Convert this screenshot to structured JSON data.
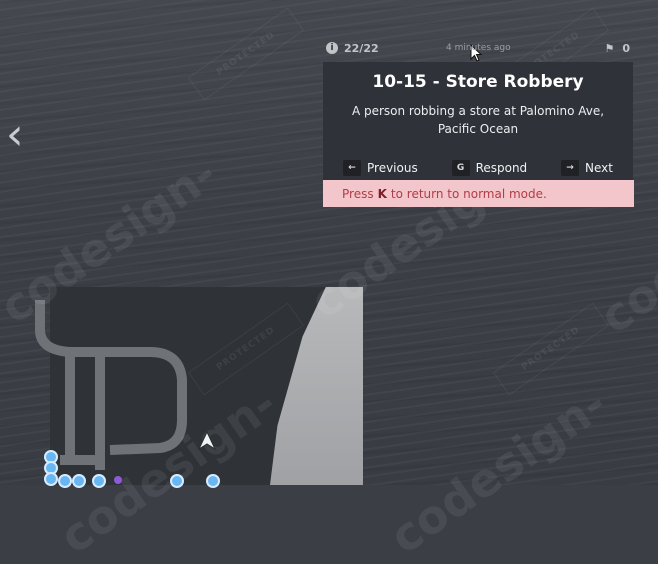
{
  "dispatch": {
    "counter": "22/22",
    "time": "4 minutes ago",
    "units_count": "0",
    "title": "10-15 - Store Robbery",
    "description": "A person robbing a store at Palomino Ave, Pacific Ocean",
    "actions": [
      {
        "key": "←",
        "label": "Previous"
      },
      {
        "key": "G",
        "label": "Respond"
      },
      {
        "key": "→",
        "label": "Next"
      }
    ],
    "notice": {
      "prefix": "Press",
      "key": "K",
      "suffix": "to return to normal mode."
    }
  },
  "watermark": {
    "text": "codesign-",
    "stamp": "PROTECTED"
  },
  "icons": {
    "info": "info-icon",
    "units": "units-icon",
    "back": "back-arrow-icon",
    "player": "player-location-arrow-icon",
    "cursor": "mouse-cursor-icon"
  },
  "colors": {
    "card_bg": "#2f3238",
    "notice_bg": "#f2c6cb",
    "notice_text": "#b23d48",
    "blip": "#69b7f2"
  }
}
